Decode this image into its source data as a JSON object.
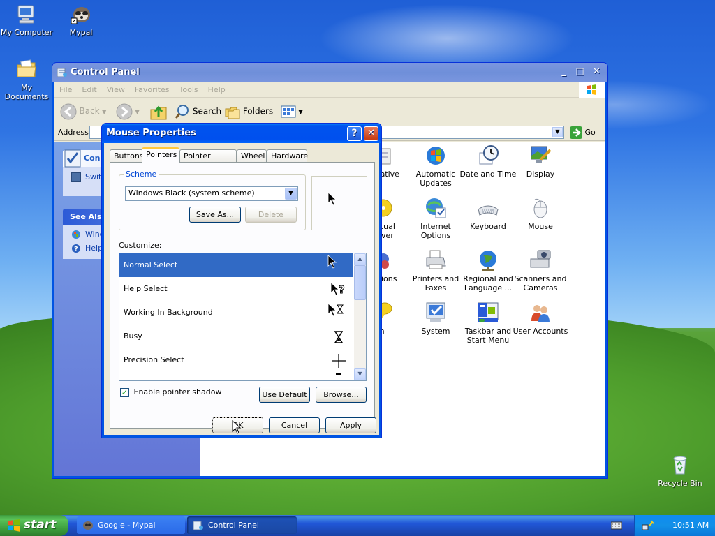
{
  "desktop": {
    "icons": [
      {
        "label": "My Computer"
      },
      {
        "label": "Mypal"
      },
      {
        "label": "My Documents"
      },
      {
        "label": "Recycle Bin"
      }
    ]
  },
  "control_panel": {
    "title": "Control Panel",
    "menu": [
      "File",
      "Edit",
      "View",
      "Favorites",
      "Tools",
      "Help"
    ],
    "toolbar": {
      "back": "Back",
      "search": "Search",
      "folders": "Folders"
    },
    "address_label": "Address",
    "go_label": "Go",
    "side": {
      "panel1_title": "Con",
      "panel1_link": "Swit",
      "panel2_title": "See Als",
      "panel2_links": [
        "Wind",
        "Help"
      ]
    },
    "items": [
      {
        "label": "strative\nols"
      },
      {
        "label": "Automatic\nUpdates"
      },
      {
        "label": "Date and Time"
      },
      {
        "label": "Display"
      },
      {
        "label": "Virtual\nDriver"
      },
      {
        "label": "Internet\nOptions"
      },
      {
        "label": "Keyboard"
      },
      {
        "label": "Mouse"
      },
      {
        "label": "Options"
      },
      {
        "label": "Printers and\nFaxes"
      },
      {
        "label": "Regional and\nLanguage ..."
      },
      {
        "label": "Scanners and\nCameras"
      },
      {
        "label": "eech"
      },
      {
        "label": "System"
      },
      {
        "label": "Taskbar and\nStart Menu"
      },
      {
        "label": "User Accounts"
      }
    ]
  },
  "dialog": {
    "title": "Mouse Properties",
    "tabs": [
      "Buttons",
      "Pointers",
      "Pointer Options",
      "Wheel",
      "Hardware"
    ],
    "active_tab": "Pointers",
    "scheme_label": "Scheme",
    "scheme_value": "Windows Black  (system scheme)",
    "save_as": "Save As...",
    "delete": "Delete",
    "customize_label": "Customize:",
    "pointers": [
      {
        "name": "Normal Select",
        "selected": true
      },
      {
        "name": "Help Select"
      },
      {
        "name": "Working In Background"
      },
      {
        "name": "Busy"
      },
      {
        "name": "Precision Select"
      }
    ],
    "shadow_label": "Enable pointer shadow",
    "shadow_checked": true,
    "use_default": "Use Default",
    "browse": "Browse...",
    "ok": "OK",
    "cancel": "Cancel",
    "apply": "Apply"
  },
  "taskbar": {
    "start": "start",
    "tasks": [
      {
        "label": "Google - Mypal",
        "active": false
      },
      {
        "label": "Control Panel",
        "active": true
      }
    ],
    "clock": "10:51 AM"
  }
}
